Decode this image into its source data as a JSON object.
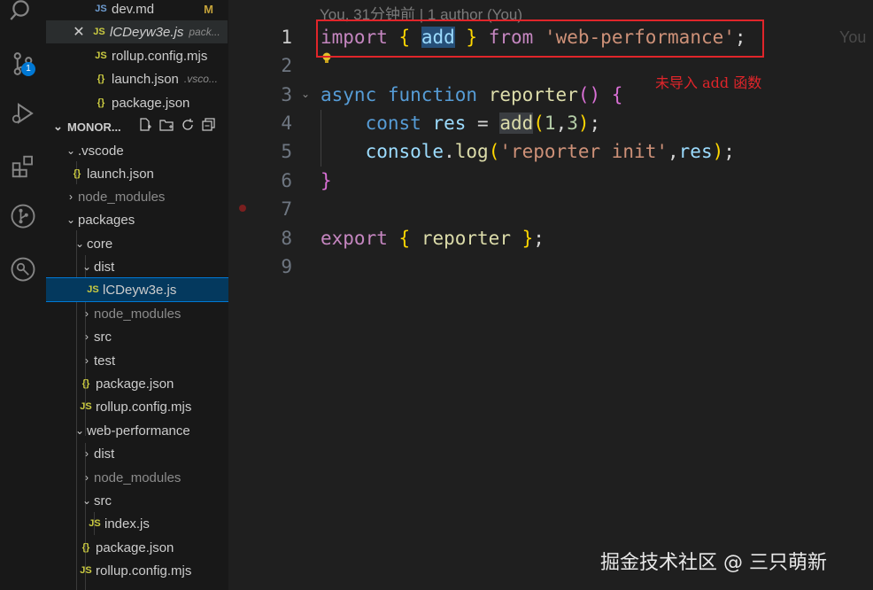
{
  "activity_bar": {
    "items": [
      {
        "name": "search-icon"
      },
      {
        "name": "source-control-icon",
        "badge": "1"
      },
      {
        "name": "run-debug-icon"
      },
      {
        "name": "extensions-icon"
      },
      {
        "name": "git-graph-icon"
      },
      {
        "name": "remote-icon"
      }
    ]
  },
  "open_editors": [
    {
      "icon": "JS",
      "label": "dev.md",
      "desc": "",
      "badge": "M"
    },
    {
      "icon": "JS",
      "label": "lCDeyw3e.js",
      "desc": "pack...",
      "close": "✕"
    },
    {
      "icon": "JS",
      "label": "rollup.config.mjs",
      "desc": ""
    },
    {
      "icon": "{}",
      "label": "launch.json",
      "desc": ".vsco..."
    },
    {
      "icon": "{}",
      "label": "package.json",
      "desc": ""
    }
  ],
  "explorer": {
    "title": "MONOR...",
    "tree": [
      {
        "label": ".vscode",
        "chev": "⌄",
        "icon": ""
      },
      {
        "label": "launch.json",
        "chev": "",
        "icon": "{}"
      },
      {
        "label": "node_modules",
        "chev": "›",
        "icon": "",
        "dim": true
      },
      {
        "label": "packages",
        "chev": "⌄",
        "icon": ""
      },
      {
        "label": "core",
        "chev": "⌄",
        "icon": ""
      },
      {
        "label": "dist",
        "chev": "⌄",
        "icon": ""
      },
      {
        "label": "lCDeyw3e.js",
        "chev": "",
        "icon": "JS",
        "active": true
      },
      {
        "label": "node_modules",
        "chev": "›",
        "icon": "",
        "dim": true
      },
      {
        "label": "src",
        "chev": "›",
        "icon": ""
      },
      {
        "label": "test",
        "chev": "›",
        "icon": ""
      },
      {
        "label": "package.json",
        "chev": "",
        "icon": "{}"
      },
      {
        "label": "rollup.config.mjs",
        "chev": "",
        "icon": "JS"
      },
      {
        "label": "web-performance",
        "chev": "⌄",
        "icon": ""
      },
      {
        "label": "dist",
        "chev": "›",
        "icon": ""
      },
      {
        "label": "node_modules",
        "chev": "›",
        "icon": "",
        "dim": true
      },
      {
        "label": "src",
        "chev": "⌄",
        "icon": ""
      },
      {
        "label": "index.js",
        "chev": "",
        "icon": "JS"
      },
      {
        "label": "package.json",
        "chev": "",
        "icon": "{}"
      },
      {
        "label": "rollup.config.mjs",
        "chev": "",
        "icon": "JS"
      }
    ]
  },
  "editor": {
    "blame": "You, 31分钟前 | 1 author (You)",
    "blame_right": "You",
    "line_numbers": [
      "1",
      "2",
      "3",
      "4",
      "5",
      "6",
      "7",
      "8",
      "9"
    ],
    "annotation": "未导入  add  函数",
    "colors": {
      "annotation": "#e0252a",
      "keyword": "#569cd6",
      "control": "#c586c0",
      "string": "#ce9178",
      "function": "#dcdcaa",
      "variable": "#9cdcfe"
    }
  },
  "watermark": "掘金技术社区 @ 三只萌新"
}
